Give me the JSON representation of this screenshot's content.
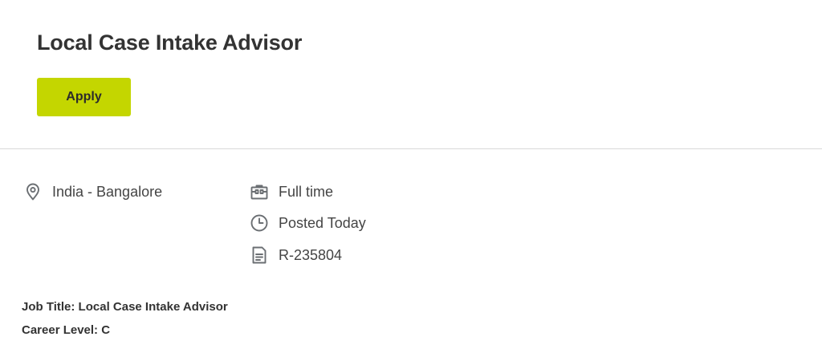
{
  "job": {
    "title": "Local Case Intake Advisor",
    "apply_label": "Apply"
  },
  "meta": {
    "location": {
      "icon": "location-pin-icon",
      "text": "India - Bangalore"
    },
    "time_type": {
      "icon": "briefcase-icon",
      "text": "Full time"
    },
    "posted": {
      "icon": "clock-icon",
      "text": "Posted Today"
    },
    "requisition": {
      "icon": "document-icon",
      "text": "R-235804"
    }
  },
  "description": {
    "job_title_line": "Job Title: Local Case Intake Advisor",
    "career_level_line": "Career Level: C"
  },
  "colors": {
    "apply_button": "#c4d600",
    "icon": "#6b6f73",
    "divider": "#d9d9d9"
  }
}
